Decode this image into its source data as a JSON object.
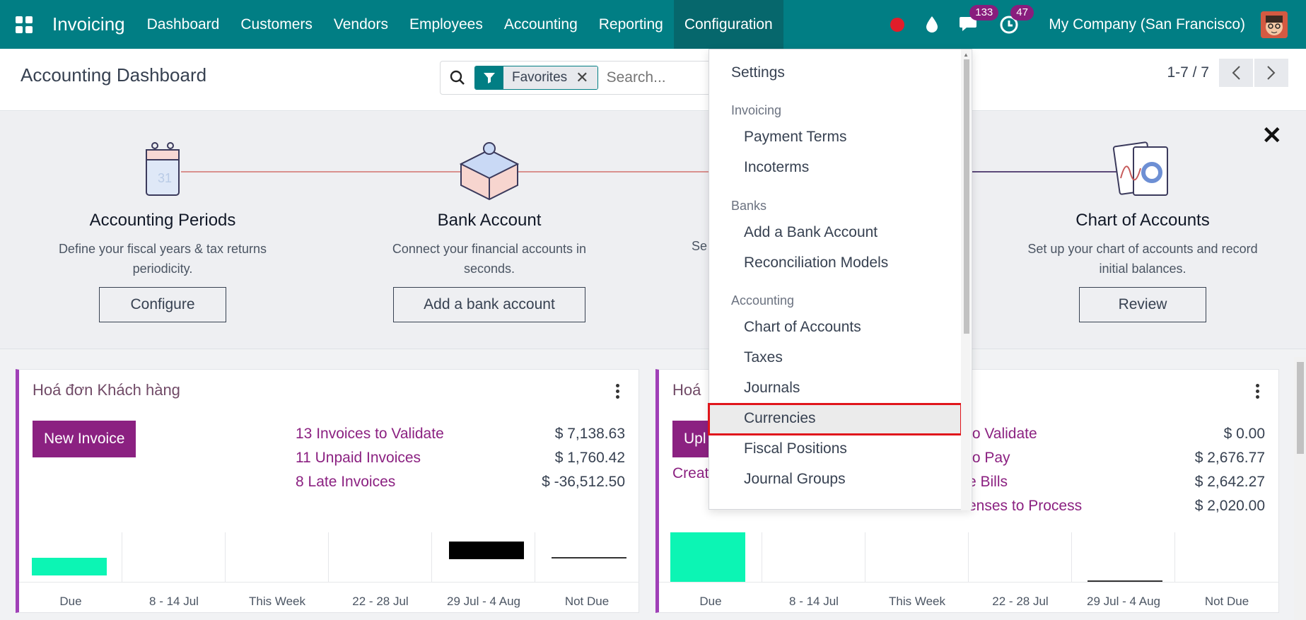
{
  "navbar": {
    "app_name": "Invoicing",
    "menu": [
      "Dashboard",
      "Customers",
      "Vendors",
      "Employees",
      "Accounting",
      "Reporting",
      "Configuration"
    ],
    "active_menu": "Configuration",
    "messages_count": "133",
    "activities_count": "47",
    "company": "My Company (San Francisco)",
    "colors": {
      "bar": "#017e84",
      "badge": "#891d7d",
      "record": "#e11d2a"
    }
  },
  "control_panel": {
    "title": "Accounting Dashboard",
    "facet_label": "Favorites",
    "search_placeholder": "Search...",
    "pager": "1-7 / 7"
  },
  "onboarding": {
    "steps": [
      {
        "title": "Accounting Periods",
        "description": "Define your fiscal years & tax returns periodicity.",
        "button": "Configure",
        "icon": "calendar-icon"
      },
      {
        "title": "Bank Account",
        "description": "Connect your financial accounts in seconds.",
        "button": "Add a bank account",
        "icon": "puzzle-icon"
      },
      {
        "title": "Chart of Accounts",
        "description": "Set up your chart of accounts and record initial balances.",
        "button": "Review",
        "icon": "chart-docs-icon"
      }
    ],
    "partial_desc_fragment": "Se"
  },
  "cards": [
    {
      "title": "Hoá đơn Khách hàng",
      "primary_button": "New Invoice",
      "stats": [
        {
          "label": "13 Invoices to Validate",
          "value": "$ 7,138.63"
        },
        {
          "label": "11 Unpaid Invoices",
          "value": "$ 1,760.42"
        },
        {
          "label": "8 Late Invoices",
          "value": "$ -36,512.50"
        }
      ],
      "graph_labels": [
        "Due",
        "8 - 14 Jul",
        "This Week",
        "22 - 28 Jul",
        "29 Jul - 4 Aug",
        "Not Due"
      ]
    },
    {
      "title_fragment": "Hoá",
      "primary_button_fragment": "Upl",
      "link_fragment": "Creat",
      "stats": [
        {
          "label": "to Validate",
          "value": "$ 0.00"
        },
        {
          "label": "to Pay",
          "value": "$ 2,676.77"
        },
        {
          "label": "e Bills",
          "value": "$ 2,642.27"
        },
        {
          "label": "enses to Process",
          "value": "$ 2,020.00"
        }
      ],
      "graph_labels": [
        "Due",
        "8 - 14 Jul",
        "This Week",
        "22 - 28 Jul",
        "29 Jul - 4 Aug",
        "Not Due"
      ]
    }
  ],
  "dropdown": {
    "settings": "Settings",
    "sections": [
      {
        "header": "Invoicing",
        "items": [
          "Payment Terms",
          "Incoterms"
        ]
      },
      {
        "header": "Banks",
        "items": [
          "Add a Bank Account",
          "Reconciliation Models"
        ]
      },
      {
        "header": "Accounting",
        "items": [
          "Chart of Accounts",
          "Taxes",
          "Journals",
          "Currencies",
          "Fiscal Positions",
          "Journal Groups"
        ]
      }
    ],
    "highlighted": "Currencies"
  }
}
